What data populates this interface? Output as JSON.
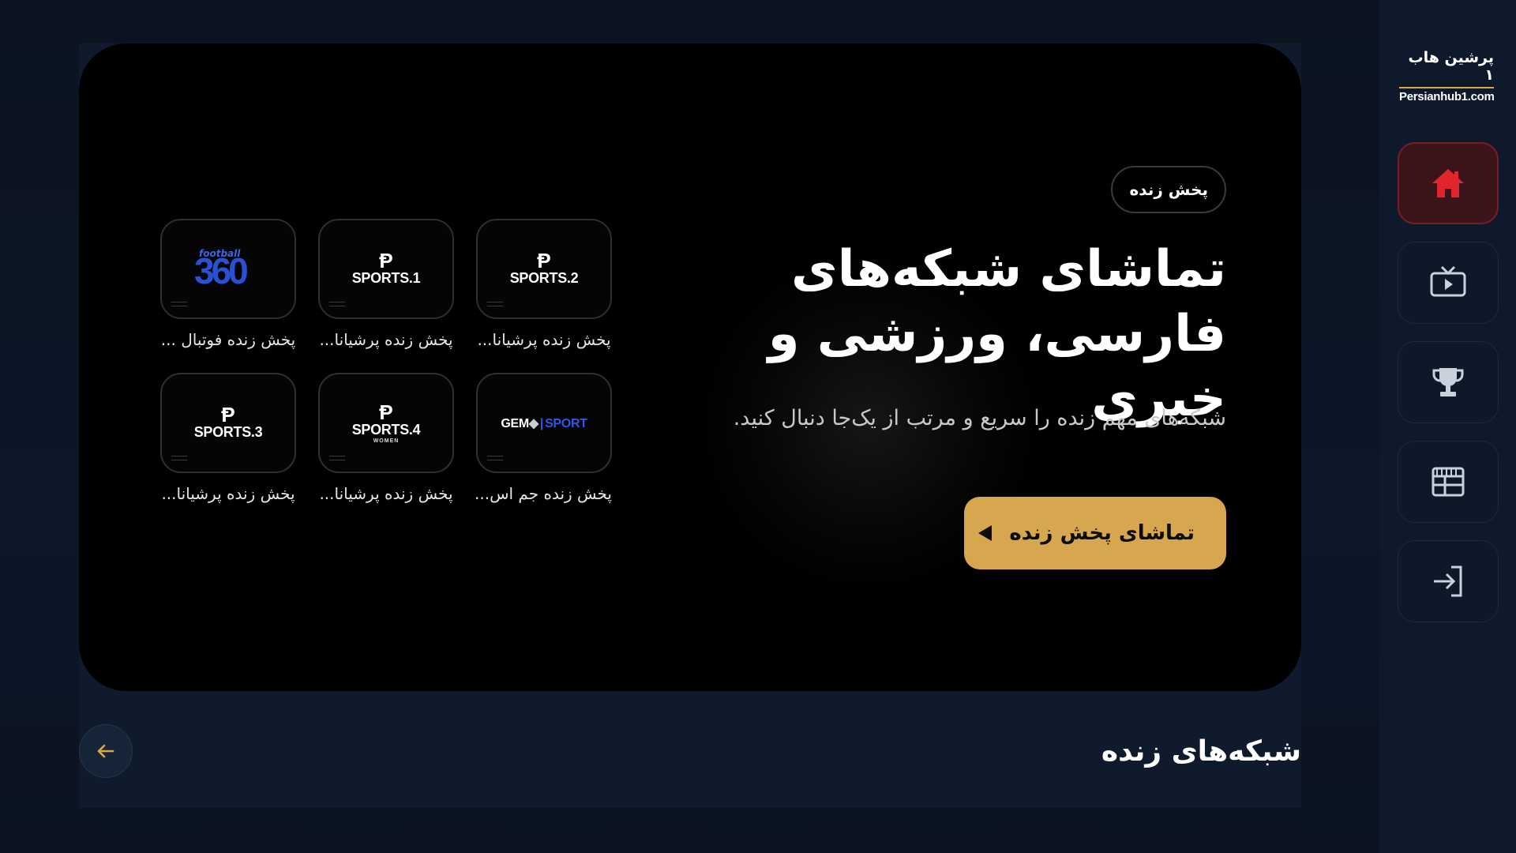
{
  "logo": {
    "text_fa": "پرشین هاب ۱",
    "text_en": "Persianhub1.com",
    "accent": "#d6a94f"
  },
  "sidebar": {
    "items": [
      {
        "name": "home",
        "icon": "home-icon",
        "active": true,
        "color": "#e0262c"
      },
      {
        "name": "live-tv",
        "icon": "tv-play-icon",
        "active": false
      },
      {
        "name": "trophy",
        "icon": "trophy-icon",
        "active": false
      },
      {
        "name": "schedule",
        "icon": "table-icon",
        "active": false
      },
      {
        "name": "login",
        "icon": "login-icon",
        "active": false
      }
    ]
  },
  "hero": {
    "badge": "پخش زنده",
    "title_line1": "تماشای شبکه‌های",
    "title_line2": "فارسی، ورزشی و خبری",
    "subtitle": "شبکه‌های مهم زنده را سریع و مرتب از یک‌جا دنبال کنید.",
    "cta_label": "تماشای پخش زنده",
    "cta_color": "#d6a74e",
    "channels": [
      {
        "name": "پخش زنده پرشیانا...",
        "logo": "SPORTS.2"
      },
      {
        "name": "پخش زنده پرشیانا...",
        "logo": "SPORTS.1"
      },
      {
        "name": "پخش زنده فوتبال ...",
        "logo": "football 360"
      },
      {
        "name": "پخش زنده جم اس...",
        "logo": "GEM | SPORT"
      },
      {
        "name": "پخش زنده پرشیانا...",
        "logo": "SPORTS.4",
        "sublogo": "WOMEN"
      },
      {
        "name": "پخش زنده پرشیانا...",
        "logo": "SPORTS.3"
      }
    ]
  },
  "section": {
    "title": "شبکه‌های زنده"
  }
}
